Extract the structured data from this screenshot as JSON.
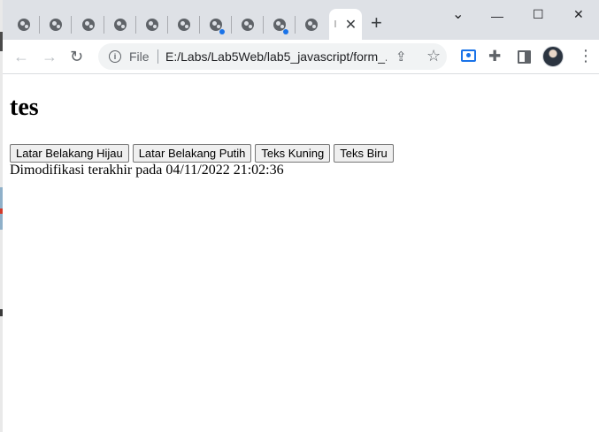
{
  "browser": {
    "tabs": [
      {
        "icon": "globe-icon",
        "dot": false
      },
      {
        "icon": "globe-icon",
        "dot": false
      },
      {
        "icon": "globe-icon",
        "dot": false
      },
      {
        "icon": "globe-icon",
        "dot": false
      },
      {
        "icon": "globe-icon",
        "dot": false
      },
      {
        "icon": "globe-icon",
        "dot": false
      },
      {
        "icon": "globe-icon",
        "dot": true
      },
      {
        "icon": "globe-icon",
        "dot": false
      },
      {
        "icon": "globe-icon",
        "dot": true
      },
      {
        "icon": "globe-icon",
        "dot": false
      }
    ],
    "active_tab_close": "✕",
    "new_tab": "+",
    "window_controls": {
      "dropdown": "⌄",
      "minimize": "—",
      "maximize": "☐",
      "close": "✕"
    },
    "address": {
      "scheme_label": "File",
      "url": "E:/Labs/Lab5Web/lab5_javascript/form_..."
    },
    "accent_color": "#1a73e8"
  },
  "page": {
    "heading": "tes",
    "buttons": [
      {
        "label": "Latar Belakang Hijau"
      },
      {
        "label": "Latar Belakang Putih"
      },
      {
        "label": "Teks Kuning"
      },
      {
        "label": "Teks Biru"
      }
    ],
    "modified_text": "Dimodifikasi terakhir pada 04/11/2022 21:02:36"
  }
}
